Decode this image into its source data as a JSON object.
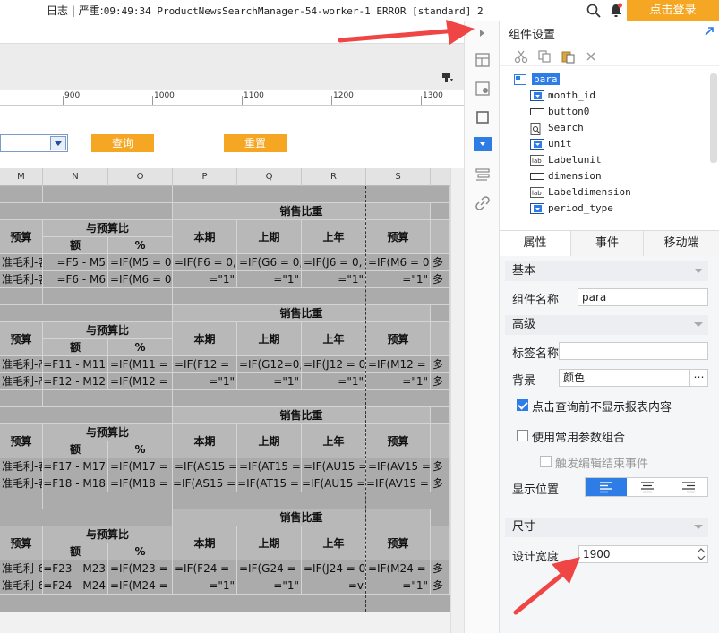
{
  "topbar": {
    "log_prefix": "日志 | 严重:",
    "log_text": "09:49:34 ProductNewsSearchManager-54-worker-1 ERROR [standard] 2",
    "login_label": "点击登录"
  },
  "toolbar": {
    "query_label": "查询",
    "reset_label": "重置"
  },
  "ruler": {
    "labels": [
      "900",
      "1000",
      "1100",
      "1200",
      "1300"
    ]
  },
  "sheet": {
    "columns": [
      "M",
      "N",
      "O",
      "P",
      "Q",
      "R",
      "S"
    ],
    "blocks": [
      {
        "title": "销售比重",
        "budget": "预算",
        "vs_budget": "与预算比",
        "amount": "额",
        "percent": "%",
        "current": "本期",
        "prev": "上期",
        "last_year": "上年",
        "budget2": "预算",
        "row1": [
          "准毛利-客",
          "=F5 - M5",
          "=IF(M5 = 0,",
          "=IF(F6 = 0,",
          "=IF(G6 = 0,",
          "=IF(J6 = 0,",
          "=IF(M6 = 0,",
          "多"
        ],
        "row2": [
          "准毛利-客",
          "=F6 - M6",
          "=IF(M6 = 0,",
          "=\"1\"",
          "=\"1\"",
          "=\"1\"",
          "=\"1\"",
          "多"
        ]
      },
      {
        "title": "销售比重",
        "budget": "预算",
        "vs_budget": "与预算比",
        "amount": "额",
        "percent": "%",
        "current": "本期",
        "prev": "上期",
        "last_year": "上年",
        "budget2": "预算",
        "row1": [
          "准毛利-产",
          "=F11 - M11",
          "=IF(M11 =",
          "=IF(F12 =",
          "=IF(G12=0,",
          "=IF(J12 = 0,",
          "=IF(M12 =",
          "多"
        ],
        "row2": [
          "准毛利-产",
          "=F12 - M12",
          "=IF(M12 =",
          "=\"1\"",
          "=\"1\"",
          "=\"1\"",
          "=\"1\"",
          "多"
        ]
      },
      {
        "title": "销售比重",
        "budget": "预算",
        "vs_budget": "与预算比",
        "amount": "额",
        "percent": "%",
        "current": "本期",
        "prev": "上期",
        "last_year": "上年",
        "budget2": "预算",
        "row1": [
          "准毛利-客",
          "=F17 - M17",
          "=IF(M17 =",
          "=IF(AS15 =",
          "=IF(AT15 =",
          "=IF(AU15 =",
          "=IF(AV15 =",
          "多"
        ],
        "row2": [
          "准毛利-客",
          "=F18 - M18",
          "=IF(M18 =",
          "=IF(AS15 =",
          "=IF(AT15 =",
          "=IF(AU15 =",
          "=IF(AV15 =",
          "多"
        ]
      },
      {
        "title": "销售比重",
        "budget": "预算",
        "vs_budget": "与预算比",
        "amount": "额",
        "percent": "%",
        "current": "本期",
        "prev": "上期",
        "last_year": "上年",
        "budget2": "预算",
        "row1": [
          "准毛利-6S",
          "=F23 - M23",
          "=IF(M23 =",
          "=IF(F24 =",
          "=IF(G24 =",
          "=IF(J24 = 0,",
          "=IF(M24 =",
          "多"
        ],
        "row2": [
          "准毛利-6S",
          "=F24 - M24",
          "=IF(M24 =",
          "=\"1\"",
          "=\"1\"",
          "=v",
          "=\"1\"",
          "多"
        ]
      }
    ]
  },
  "props": {
    "title": "组件设置",
    "tree": [
      {
        "label": "para",
        "icon": "form-icon",
        "selected": true
      },
      {
        "label": "month_id",
        "icon": "combo-icon"
      },
      {
        "label": "button0",
        "icon": "button-icon"
      },
      {
        "label": "Search",
        "icon": "search-doc-icon"
      },
      {
        "label": "unit",
        "icon": "combo-icon"
      },
      {
        "label": "Labelunit",
        "icon": "label-icon"
      },
      {
        "label": "dimension",
        "icon": "button-icon"
      },
      {
        "label": "Labeldimension",
        "icon": "label-icon"
      },
      {
        "label": "period_type",
        "icon": "combo-icon"
      }
    ],
    "tabs": [
      "属性",
      "事件",
      "移动端"
    ],
    "sections": {
      "basic": "基本",
      "advanced": "高级",
      "size": "尺寸"
    },
    "fields": {
      "component_name_label": "组件名称",
      "component_name_value": "para",
      "tag_name_label": "标签名称",
      "tag_name_value": "",
      "background_label": "背景",
      "background_value": "颜色",
      "hide_before_query": "点击查询前不显示报表内容",
      "use_common_params": "使用常用参数组合",
      "trigger_on_edit": "触发编辑结束事件",
      "display_position_label": "显示位置",
      "design_width_label": "设计宽度",
      "design_width_value": "1900"
    },
    "colors": {
      "accent": "#2e7ce6",
      "orange": "#f5a623",
      "arrow": "#f04545"
    }
  }
}
